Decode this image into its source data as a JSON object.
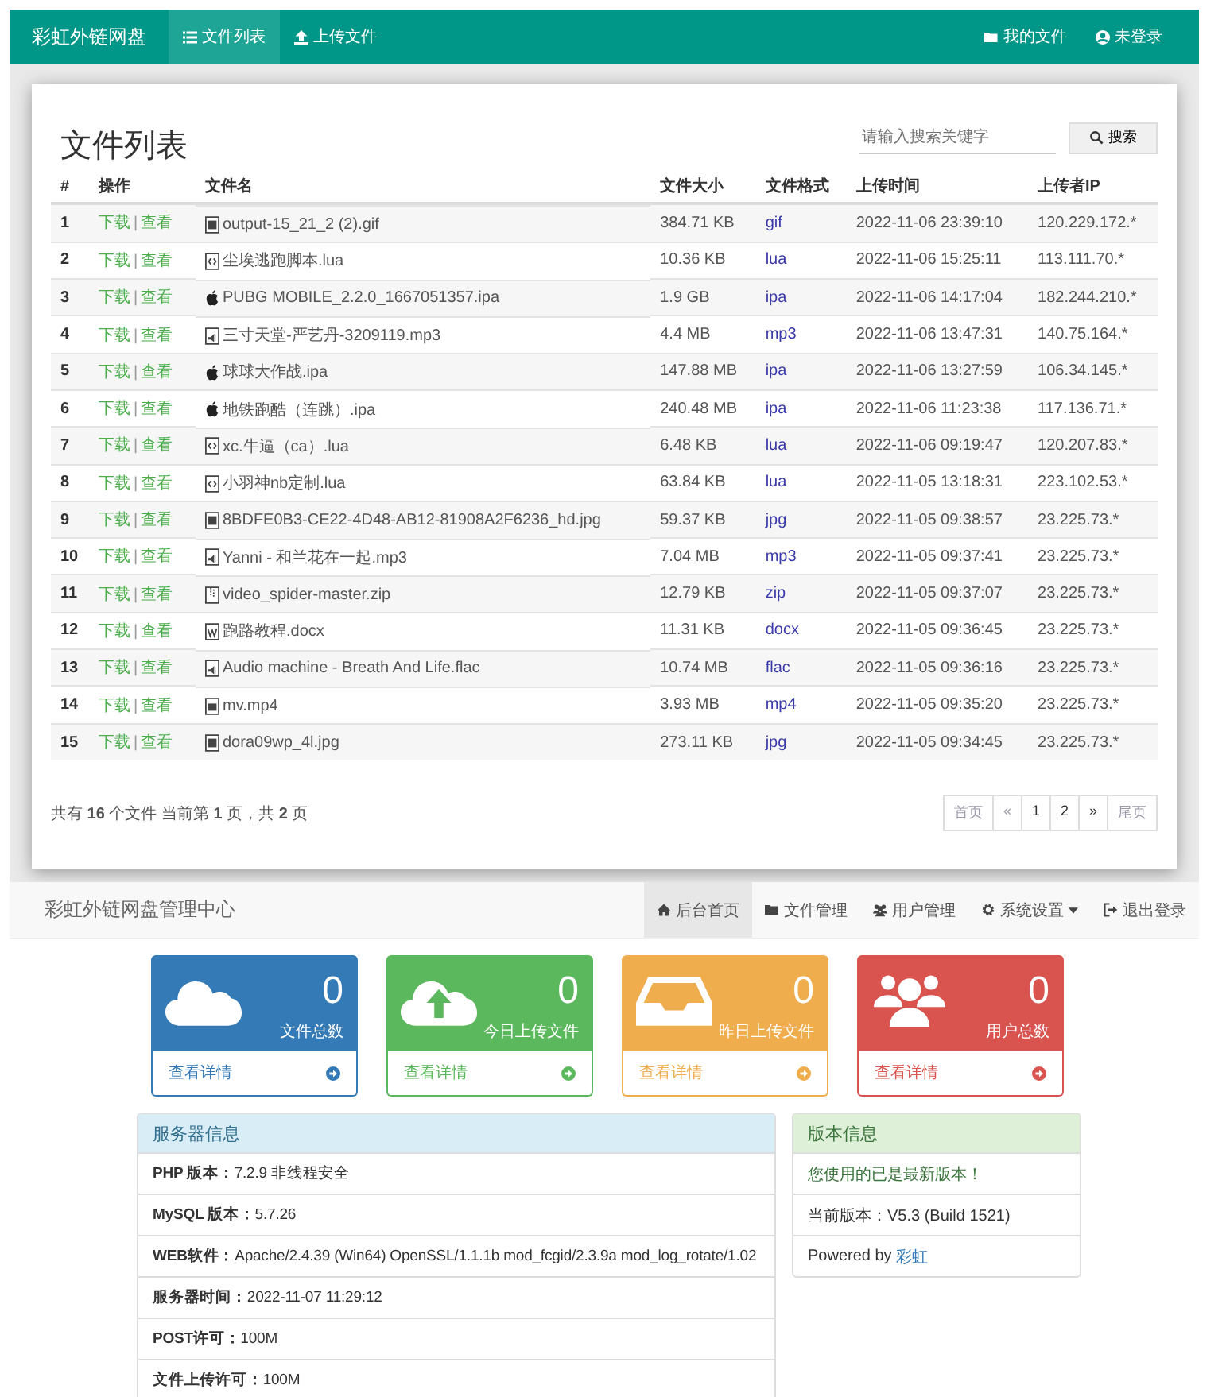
{
  "navbar": {
    "brand": "彩虹外链网盘",
    "items": [
      {
        "label": "文件列表",
        "kind": "list",
        "selected": true
      },
      {
        "label": "上传文件",
        "kind": "upload",
        "selected": false
      }
    ],
    "right_items": [
      {
        "label": "我的文件",
        "kind": "folder"
      },
      {
        "label": "未登录",
        "kind": "user"
      }
    ]
  },
  "file_list": {
    "title": "文件列表",
    "search": {
      "placeholder": "请输入搜索关键字",
      "button": "搜索"
    },
    "columns": [
      "#",
      "操作",
      "文件名",
      "文件大小",
      "文件格式",
      "上传时间",
      "上传者IP"
    ],
    "rows": [
      {
        "no": "1",
        "actions": [
          "下载",
          "查看"
        ],
        "separator": "|",
        "kind": "image",
        "name": "output-15_21_2 (2).gif",
        "size": "384.71 KB",
        "format": "gif",
        "time": "2022-11-06 23:39:10",
        "ip": "120.229.172.*"
      },
      {
        "no": "2",
        "actions": [
          "下载",
          "查看"
        ],
        "separator": "|",
        "kind": "code",
        "name": "尘埃逃跑脚本.lua",
        "size": "10.36 KB",
        "format": "lua",
        "time": "2022-11-06 15:25:11",
        "ip": "113.111.70.*"
      },
      {
        "no": "3",
        "actions": [
          "下载",
          "查看"
        ],
        "separator": "|",
        "kind": "apple",
        "name": "PUBG MOBILE_2.2.0_1667051357.ipa",
        "size": "1.9 GB",
        "format": "ipa",
        "time": "2022-11-06 14:17:04",
        "ip": "182.244.210.*"
      },
      {
        "no": "4",
        "actions": [
          "下载",
          "查看"
        ],
        "separator": "|",
        "kind": "audio",
        "name": "三寸天堂-严艺丹-3209119.mp3",
        "size": "4.4 MB",
        "format": "mp3",
        "time": "2022-11-06 13:47:31",
        "ip": "140.75.164.*"
      },
      {
        "no": "5",
        "actions": [
          "下载",
          "查看"
        ],
        "separator": "|",
        "kind": "apple",
        "name": "球球大作战.ipa",
        "size": "147.88 MB",
        "format": "ipa",
        "time": "2022-11-06 13:27:59",
        "ip": "106.34.145.*"
      },
      {
        "no": "6",
        "actions": [
          "下载",
          "查看"
        ],
        "separator": "|",
        "kind": "apple",
        "name": "地铁跑酷（连跳）.ipa",
        "size": "240.48 MB",
        "format": "ipa",
        "time": "2022-11-06 11:23:38",
        "ip": "117.136.71.*"
      },
      {
        "no": "7",
        "actions": [
          "下载",
          "查看"
        ],
        "separator": "|",
        "kind": "code",
        "name": "xc.牛逼（ca）.lua",
        "size": "6.48 KB",
        "format": "lua",
        "time": "2022-11-06 09:19:47",
        "ip": "120.207.83.*"
      },
      {
        "no": "8",
        "actions": [
          "下载",
          "查看"
        ],
        "separator": "|",
        "kind": "code",
        "name": "小羽神nb定制.lua",
        "size": "63.84 KB",
        "format": "lua",
        "time": "2022-11-05 13:18:31",
        "ip": "223.102.53.*"
      },
      {
        "no": "9",
        "actions": [
          "下载",
          "查看"
        ],
        "separator": "|",
        "kind": "image",
        "name": "8BDFE0B3-CE22-4D48-AB12-81908A2F6236_hd.jpg",
        "size": "59.37 KB",
        "format": "jpg",
        "time": "2022-11-05 09:38:57",
        "ip": "23.225.73.*"
      },
      {
        "no": "10",
        "actions": [
          "下载",
          "查看"
        ],
        "separator": "|",
        "kind": "audio",
        "name": "Yanni - 和兰花在一起.mp3",
        "size": "7.04 MB",
        "format": "mp3",
        "time": "2022-11-05 09:37:41",
        "ip": "23.225.73.*"
      },
      {
        "no": "11",
        "actions": [
          "下载",
          "查看"
        ],
        "separator": "|",
        "kind": "archive",
        "name": "video_spider-master.zip",
        "size": "12.79 KB",
        "format": "zip",
        "time": "2022-11-05 09:37:07",
        "ip": "23.225.73.*"
      },
      {
        "no": "12",
        "actions": [
          "下载",
          "查看"
        ],
        "separator": "|",
        "kind": "word",
        "name": "跑路教程.docx",
        "size": "11.31 KB",
        "format": "docx",
        "time": "2022-11-05 09:36:45",
        "ip": "23.225.73.*"
      },
      {
        "no": "13",
        "actions": [
          "下载",
          "查看"
        ],
        "separator": "|",
        "kind": "audio",
        "name": "Audio machine - Breath And Life.flac",
        "size": "10.74 MB",
        "format": "flac",
        "time": "2022-11-05 09:36:16",
        "ip": "23.225.73.*"
      },
      {
        "no": "14",
        "actions": [
          "下载",
          "查看"
        ],
        "separator": "|",
        "kind": "video",
        "name": "mv.mp4",
        "size": "3.93 MB",
        "format": "mp4",
        "time": "2022-11-05 09:35:20",
        "ip": "23.225.73.*"
      },
      {
        "no": "15",
        "actions": [
          "下载",
          "查看"
        ],
        "separator": "|",
        "kind": "image",
        "name": "dora09wp_4l.jpg",
        "size": "273.11 KB",
        "format": "jpg",
        "time": "2022-11-05 09:34:45",
        "ip": "23.225.73.*"
      }
    ],
    "summary": "共有 **16** 个文件  当前第 **1** 页，共 **2** 页",
    "pagination": [
      {
        "label": "首页",
        "disabled": true
      },
      {
        "label": "«",
        "disabled": true
      },
      {
        "label": "1",
        "disabled": false
      },
      {
        "label": "2",
        "disabled": false
      },
      {
        "label": "»",
        "disabled": false
      },
      {
        "label": "尾页",
        "disabled": true
      }
    ]
  },
  "admin_nav": {
    "brand": "彩虹外链网盘管理中心",
    "items": [
      {
        "label": "后台首页",
        "kind": "home",
        "selected": true,
        "dropdown": false
      },
      {
        "label": "文件管理",
        "kind": "folder",
        "selected": false,
        "dropdown": false
      },
      {
        "label": "用户管理",
        "kind": "users",
        "selected": false,
        "dropdown": false
      },
      {
        "label": "系统设置",
        "kind": "gear",
        "selected": false,
        "dropdown": true
      },
      {
        "label": "退出登录",
        "kind": "logout",
        "selected": false,
        "dropdown": false
      }
    ]
  },
  "stats": [
    {
      "kind": "cloud",
      "color": "#337ab7",
      "count": "0",
      "label": "文件总数",
      "link": "查看详情"
    },
    {
      "kind": "cloud-upload",
      "color": "#5cb85c",
      "count": "0",
      "label": "今日上传文件",
      "link": "查看详情"
    },
    {
      "kind": "inbox",
      "color": "#f0ad4e",
      "count": "0",
      "label": "昨日上传文件",
      "link": "查看详情"
    },
    {
      "kind": "users",
      "color": "#d9534f",
      "count": "0",
      "label": "用户总数",
      "link": "查看详情"
    }
  ],
  "server_info": {
    "title": "服务器信息",
    "rows": [
      "**PHP 版本：**7.2.9 非线程安全",
      "**MySQL 版本：**5.7.26",
      "**WEB软件：**Apache/2.4.39 (Win64) OpenSSL/1.1.1b mod_fcgid/2.3.9a mod_log_rotate/1.02",
      "**服务器时间：**2022-11-07 11:29:12",
      "**POST许可：**100M",
      "**文件上传许可：**100M"
    ]
  },
  "version_info": {
    "title": "版本信息",
    "latest": "您使用的已是最新版本！",
    "current": "当前版本：V5.3 (Build 1521)",
    "powered": "Powered by",
    "author": "彩虹"
  }
}
